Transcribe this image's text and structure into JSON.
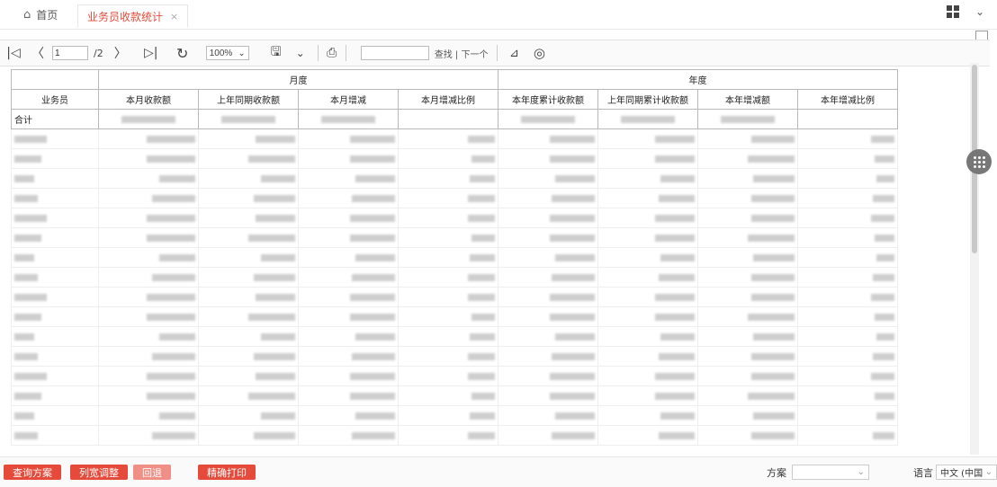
{
  "tabs": {
    "home_icon": "home-icon",
    "home_label": "首页",
    "active_label": "业务员收款统计",
    "active_close": "×"
  },
  "topright": {
    "grid_icon": "grid-icon",
    "chevron": "⌄"
  },
  "toolbar": {
    "first": "|◁",
    "prev": "〈",
    "page_value": "1",
    "page_total": "/2",
    "next": "〉",
    "last": "▷|",
    "refresh": "↻",
    "zoom": "100%",
    "zoom_arrow": "⌄",
    "save": "🖫",
    "save_arrow": "⌄",
    "print": "⎙",
    "search_links": "查找 | 下一个",
    "feed": "⊿",
    "camera": "◎"
  },
  "report": {
    "group_month": "月度",
    "group_year": "年度",
    "columns": [
      "业务员",
      "本月收款额",
      "上年同期收款额",
      "本月增减",
      "本月增减比例",
      "本年度累计收款额",
      "上年同期累计收款额",
      "本年增减额",
      "本年增减比例"
    ],
    "total_label": "合计",
    "pct_mark": "%"
  },
  "bottom": {
    "btn_query": "查询方案",
    "btn_colwidth": "列宽调整",
    "btn_back": "回退",
    "btn_print": "精确打印",
    "scheme_label": "方案",
    "scheme_value": "",
    "lang_label": "语言",
    "lang_value": "中文 (中国"
  }
}
